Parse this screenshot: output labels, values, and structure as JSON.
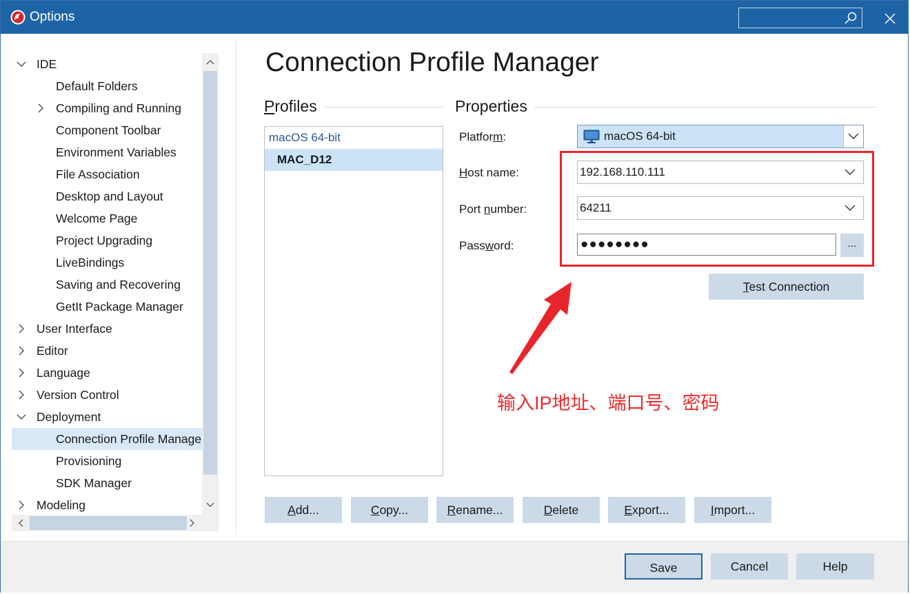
{
  "window": {
    "title": "Options",
    "search_placeholder": ""
  },
  "tree": {
    "items": [
      {
        "label": "IDE",
        "level": 0,
        "expand": "expanded"
      },
      {
        "label": "Default Folders",
        "level": 1,
        "expand": "none"
      },
      {
        "label": "Compiling and Running",
        "level": 1,
        "expand": "collapsed"
      },
      {
        "label": "Component Toolbar",
        "level": 1,
        "expand": "none"
      },
      {
        "label": "Environment Variables",
        "level": 1,
        "expand": "none"
      },
      {
        "label": "File Association",
        "level": 1,
        "expand": "none"
      },
      {
        "label": "Desktop and Layout",
        "level": 1,
        "expand": "none"
      },
      {
        "label": "Welcome Page",
        "level": 1,
        "expand": "none"
      },
      {
        "label": "Project Upgrading",
        "level": 1,
        "expand": "none"
      },
      {
        "label": "LiveBindings",
        "level": 1,
        "expand": "none"
      },
      {
        "label": "Saving and Recovering",
        "level": 1,
        "expand": "none"
      },
      {
        "label": "GetIt Package Manager",
        "level": 1,
        "expand": "none"
      },
      {
        "label": "User Interface",
        "level": 0,
        "expand": "collapsed"
      },
      {
        "label": "Editor",
        "level": 0,
        "expand": "collapsed"
      },
      {
        "label": "Language",
        "level": 0,
        "expand": "collapsed"
      },
      {
        "label": "Version Control",
        "level": 0,
        "expand": "collapsed"
      },
      {
        "label": "Deployment",
        "level": 0,
        "expand": "expanded"
      },
      {
        "label": "Connection Profile Manager",
        "level": 1,
        "expand": "none",
        "selected": true
      },
      {
        "label": "Provisioning",
        "level": 1,
        "expand": "none"
      },
      {
        "label": "SDK Manager",
        "level": 1,
        "expand": "none"
      },
      {
        "label": "Modeling",
        "level": 0,
        "expand": "collapsed"
      }
    ]
  },
  "page": {
    "heading": "Connection Profile Manager"
  },
  "profiles": {
    "title_prefix": "P",
    "title_rest": "rofiles",
    "category": "macOS 64-bit",
    "selected_profile": "MAC_D12"
  },
  "properties": {
    "title": "Properties",
    "platform": {
      "label_a": "Platfor",
      "label_u": "m",
      "label_b": ":",
      "value": "macOS 64-bit",
      "icon": "monitor-icon"
    },
    "host": {
      "label_u": "H",
      "label_b": "ost name:",
      "value": "192.168.110.111"
    },
    "port": {
      "label_a": "Port ",
      "label_u": "n",
      "label_b": "umber:",
      "value": "64211"
    },
    "password": {
      "label_a": "Pass",
      "label_u": "w",
      "label_b": "ord:",
      "value": "●●●●●●●●",
      "browse_label": "..."
    },
    "test_connection": {
      "u": "T",
      "rest": "est Connection"
    }
  },
  "profile_buttons": [
    {
      "u": "A",
      "rest": "dd..."
    },
    {
      "u": "C",
      "rest": "opy..."
    },
    {
      "u": "R",
      "rest": "ename..."
    },
    {
      "u": "D",
      "rest": "elete"
    },
    {
      "u": "E",
      "rest": "xport..."
    },
    {
      "u": "I",
      "rest": "mport..."
    }
  ],
  "footer": {
    "save": "Save",
    "cancel": "Cancel",
    "help": "Help"
  },
  "annotation": {
    "text": "输入IP地址、端口号、密码",
    "color": "#ee2a2a"
  },
  "colors": {
    "titlebar": "#1d64a6",
    "selection": "#cce3f7",
    "button": "#ccdae8",
    "annotation": "#e8252b"
  }
}
